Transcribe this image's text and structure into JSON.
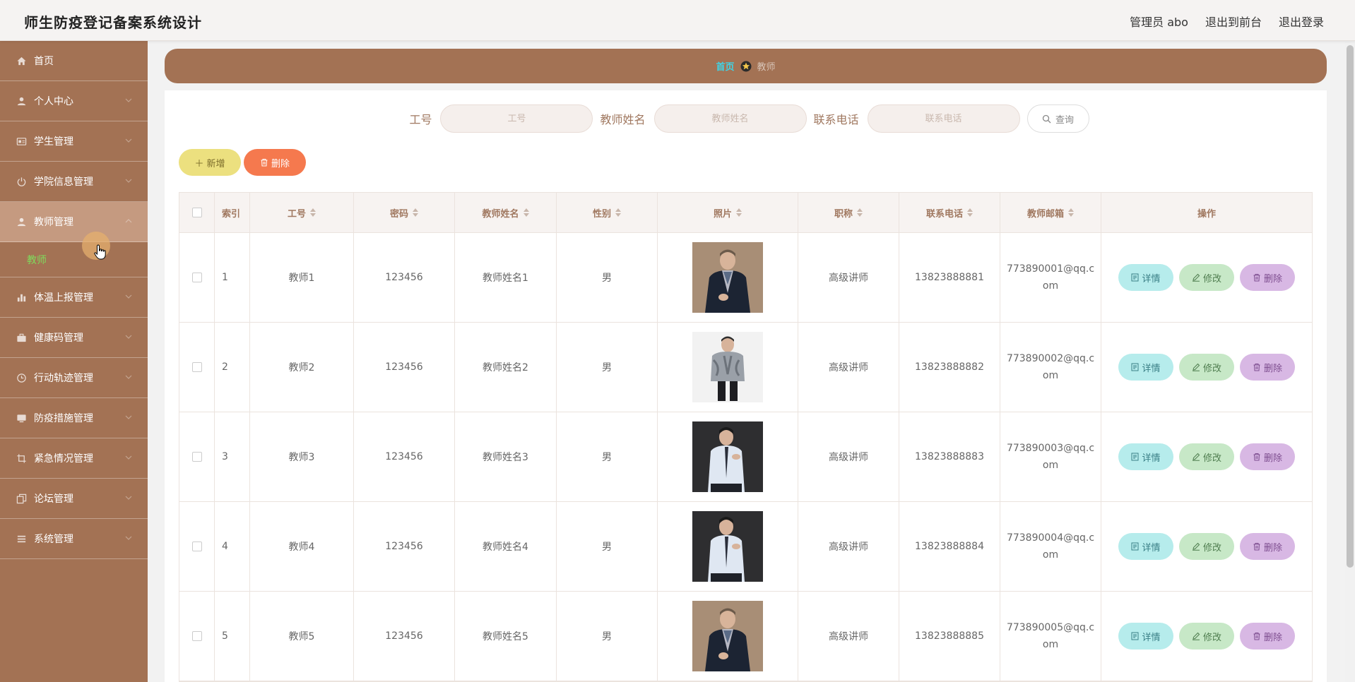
{
  "header": {
    "title": "师生防疫登记备案系统设计",
    "admin": "管理员 abo",
    "to_front": "退出到前台",
    "logout": "退出登录"
  },
  "sidebar": {
    "items": [
      {
        "label": "首页",
        "icon": "home-icon"
      },
      {
        "label": "个人中心",
        "icon": "user-icon"
      },
      {
        "label": "学生管理",
        "icon": "id-card-icon"
      },
      {
        "label": "学院信息管理",
        "icon": "power-icon"
      },
      {
        "label": "教师管理",
        "icon": "user-icon"
      },
      {
        "label": "体温上报管理",
        "icon": "bar-chart-icon"
      },
      {
        "label": "健康码管理",
        "icon": "briefcase-icon"
      },
      {
        "label": "行动轨迹管理",
        "icon": "clock-icon"
      },
      {
        "label": "防疫措施管理",
        "icon": "monitor-icon"
      },
      {
        "label": "紧急情况管理",
        "icon": "crop-icon"
      },
      {
        "label": "论坛管理",
        "icon": "copy-icon"
      },
      {
        "label": "系统管理",
        "icon": "menu-icon"
      }
    ],
    "submenu": {
      "label": "教师"
    }
  },
  "breadcrumb": {
    "home": "首页",
    "current": "教师"
  },
  "search": {
    "gonghao_label": "工号",
    "gonghao_placeholder": "工号",
    "name_label": "教师姓名",
    "name_placeholder": "教师姓名",
    "phone_label": "联系电话",
    "phone_placeholder": "联系电话",
    "button": "查询"
  },
  "actions": {
    "add": "新增",
    "delete": "删除"
  },
  "table": {
    "headers": [
      "索引",
      "工号",
      "密码",
      "教师姓名",
      "性别",
      "照片",
      "职称",
      "联系电话",
      "教师邮箱",
      "操作"
    ],
    "op_labels": {
      "detail": "详情",
      "edit": "修改",
      "delete": "删除"
    },
    "rows": [
      {
        "index": "1",
        "gonghao": "教师1",
        "password": "123456",
        "name": "教师姓名1",
        "gender": "男",
        "title": "高级讲师",
        "phone": "13823888881",
        "email": "773890001@qq.com",
        "photo": "man-suit-scarf"
      },
      {
        "index": "2",
        "gonghao": "教师2",
        "password": "123456",
        "name": "教师姓名2",
        "gender": "男",
        "title": "高级讲师",
        "phone": "13823888882",
        "email": "773890002@qq.com",
        "photo": "man-silver-jacket"
      },
      {
        "index": "3",
        "gonghao": "教师3",
        "password": "123456",
        "name": "教师姓名3",
        "gender": "男",
        "title": "高级讲师",
        "phone": "13823888883",
        "email": "773890003@qq.com",
        "photo": "man-white-shirt"
      },
      {
        "index": "4",
        "gonghao": "教师4",
        "password": "123456",
        "name": "教师姓名4",
        "gender": "男",
        "title": "高级讲师",
        "phone": "13823888884",
        "email": "773890004@qq.com",
        "photo": "man-white-shirt"
      },
      {
        "index": "5",
        "gonghao": "教师5",
        "password": "123456",
        "name": "教师姓名5",
        "gender": "男",
        "title": "高级讲师",
        "phone": "13823888885",
        "email": "773890005@qq.com",
        "photo": "man-suit-scarf"
      }
    ]
  },
  "colors": {
    "sidebar_bg": "#a37254",
    "active_item": "#c59a80",
    "submenu_text": "#7fdc5c",
    "breadcrumb_home": "#3fd4e6",
    "add_button": "#ece07f",
    "delete_button": "#f5794e",
    "detail_button": "#b6ecec",
    "edit_button": "#c7e8c7",
    "row_delete_button": "#d8b8e4"
  }
}
